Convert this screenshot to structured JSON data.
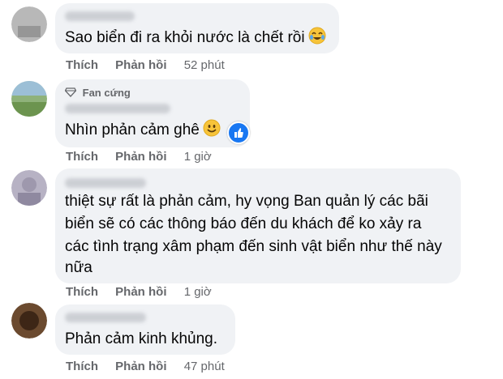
{
  "labels": {
    "like": "Thích",
    "reply": "Phản hồi"
  },
  "comments": [
    {
      "text": "Sao biển đi ra khỏi nước là chết rồi",
      "emoji": "crying-laughing-icon",
      "time": "52 phút"
    },
    {
      "badge": "Fan cứng",
      "text": "Nhìn phản cảm ghê",
      "emoji": "smile-icon",
      "reaction": "like-reaction-icon",
      "time": "1 giờ"
    },
    {
      "lines": [
        "thiệt sự rất là phản cảm, hy vọng Ban quản lý các bãi",
        "biển sẽ có các thông báo đến du khách để ko xảy ra",
        "các tình trạng xâm phạm đến sinh vật biển như thế này",
        "nữa"
      ],
      "time": "1 giờ"
    },
    {
      "text": "Phản cảm kinh khủng.",
      "time": "47 phút"
    }
  ],
  "colors": {
    "bubble": "#f0f2f5",
    "action_text": "#65676b",
    "like_blue": "#1877f2"
  }
}
